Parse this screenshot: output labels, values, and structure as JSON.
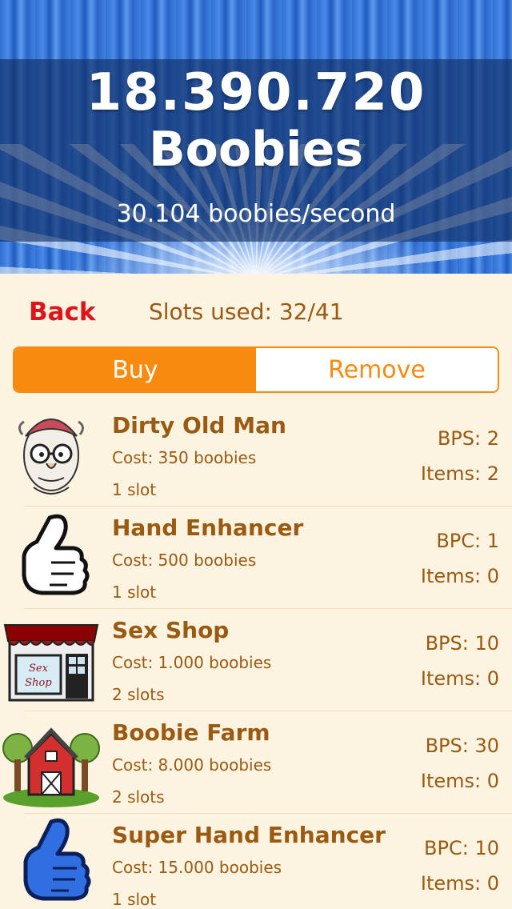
{
  "header": {
    "total": "18.390.720",
    "unit": "Boobies",
    "rate": "30.104 boobies/second"
  },
  "topbar": {
    "back_label": "Back",
    "slots_used": "Slots used: 32/41"
  },
  "segment": {
    "buy_label": "Buy",
    "remove_label": "Remove",
    "selected": "Buy"
  },
  "items": [
    {
      "name": "Dirty Old Man",
      "cost": "Cost: 350 boobies",
      "slots": "1 slot",
      "stat": "BPS: 2",
      "count": "Items: 2",
      "icon": "old-man-icon"
    },
    {
      "name": "Hand Enhancer",
      "cost": "Cost: 500 boobies",
      "slots": "1 slot",
      "stat": "BPC: 1",
      "count": "Items: 0",
      "icon": "white-glove-hand-icon"
    },
    {
      "name": "Sex Shop",
      "cost": "Cost: 1.000 boobies",
      "slots": "2 slots",
      "stat": "BPS: 10",
      "count": "Items: 0",
      "icon": "shop-icon",
      "icon_text": "Sex Shop"
    },
    {
      "name": "Boobie Farm",
      "cost": "Cost: 8.000 boobies",
      "slots": "2 slots",
      "stat": "BPS: 30",
      "count": "Items: 0",
      "icon": "barn-farm-icon"
    },
    {
      "name": "Super Hand Enhancer",
      "cost": "Cost: 15.000 boobies",
      "slots": "1 slot",
      "stat": "BPC: 10",
      "count": "Items: 0",
      "icon": "blue-glove-hand-icon"
    }
  ],
  "colors": {
    "accent": "#f88a10",
    "text_brown": "#9a5a12",
    "back_red": "#e0121a",
    "background": "#fdf3e1"
  }
}
